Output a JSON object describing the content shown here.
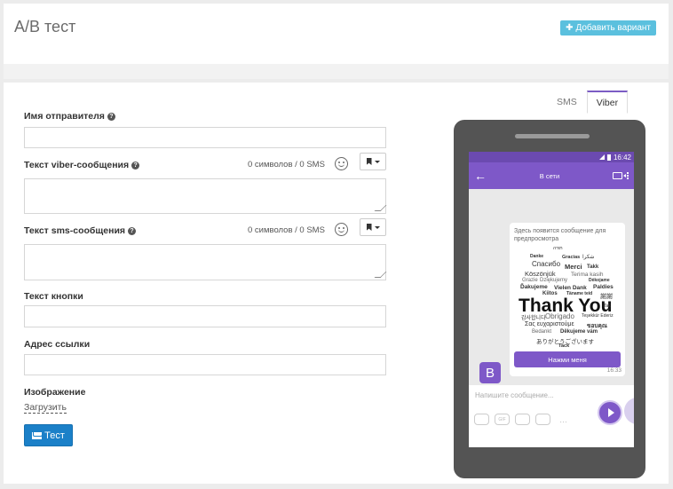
{
  "header": {
    "title": "A/B тест",
    "add_variant_label": "Добавить вариант"
  },
  "form": {
    "sender_label": "Имя отправителя",
    "viber_label": "Текст viber-сообщения",
    "viber_counter": "0 символов  /  0 SMS",
    "sms_label": "Текст sms-сообщения",
    "sms_counter": "0 символов  /  0 SMS",
    "button_text_label": "Текст кнопки",
    "link_label": "Адрес ссылки",
    "image_label": "Изображение",
    "upload_label": "Загрузить",
    "test_button_label": "Тест"
  },
  "tabs": [
    {
      "label": "SMS"
    },
    {
      "label": "Viber",
      "active": true
    }
  ],
  "phone": {
    "time": "16:42",
    "conversation_title": "В сети",
    "preview_text": "Здесь появится сообщение для предпросмотра",
    "thank_you_words": [
      "תודה",
      "Danke",
      "Gracias",
      "شكرا",
      "Спасибо",
      "Merci",
      "Takk",
      "Köszönjük",
      "Grazie",
      "Dziękujemy",
      "Terima kasih",
      "Dėkojame",
      "Ďakujeme",
      "Vielen Dank",
      "Paldies",
      "Kiitos",
      "Täname teid",
      "謝謝",
      "Thank You",
      "Tak",
      "감사합니다",
      "Obrigado",
      "Teşekkür Ederiz",
      "Σας ευχαριστούμε",
      "ขอบคุณ",
      "Bedankt",
      "Děkujeme vám",
      "ありがとうございます",
      "Tack"
    ],
    "bubble_button": "Нажми меня",
    "bubble_time": "16:33",
    "avatar_letter": "B",
    "message_placeholder": "Напишите сообщение..."
  },
  "colors": {
    "viber_purple": "#7e58c8",
    "info_blue": "#5bc0de",
    "primary_blue": "#1b80c8"
  }
}
